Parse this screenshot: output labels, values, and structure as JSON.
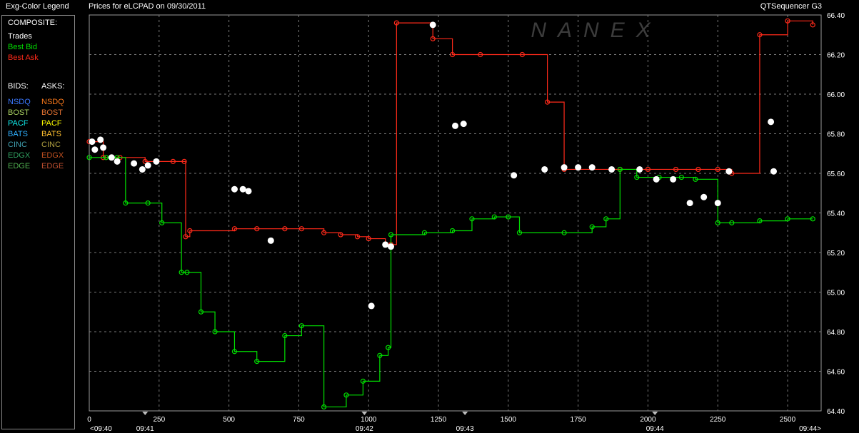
{
  "window": {
    "legend_title": "Exg-Color Legend",
    "chart_title": "Prices for  eLCPAD  on  09/30/2011",
    "app_name": "QTSequencer G3",
    "watermark": "NANEX"
  },
  "legend": {
    "composite_header": "COMPOSITE:",
    "composite": [
      {
        "label": "Trades",
        "color": "#ffffff"
      },
      {
        "label": "Best Bid",
        "color": "#00e000"
      },
      {
        "label": "Best Ask",
        "color": "#ff2a1a"
      }
    ],
    "bids_header": "BIDS:",
    "asks_header": "ASKS:",
    "exchanges": [
      {
        "bid": "NSDQ",
        "bid_color": "#3a78ff",
        "ask": "NSDQ",
        "ask_color": "#ff7a1a"
      },
      {
        "bid": "BOST",
        "bid_color": "#a8d060",
        "ask": "BOST",
        "ask_color": "#e07030"
      },
      {
        "bid": "PACF",
        "bid_color": "#10f0f0",
        "ask": "PACF",
        "ask_color": "#ffff00"
      },
      {
        "bid": "BATS",
        "bid_color": "#30b0ff",
        "ask": "BATS",
        "ask_color": "#ffc030"
      },
      {
        "bid": "CINC",
        "bid_color": "#40a0b0",
        "ask": "CINC",
        "ask_color": "#b0a040"
      },
      {
        "bid": "EDGX",
        "bid_color": "#30a060",
        "ask": "EDGX",
        "ask_color": "#c05020"
      },
      {
        "bid": "EDGE",
        "bid_color": "#50b050",
        "ask": "EDGE",
        "ask_color": "#c05030"
      }
    ]
  },
  "chart_data": {
    "type": "line",
    "title": "Prices for  eLCPAD  on  09/30/2011",
    "y_ticks": [
      "66.40",
      "66.20",
      "66.00",
      "65.80",
      "65.60",
      "65.40",
      "65.20",
      "65.00",
      "64.80",
      "64.60",
      "64.40"
    ],
    "ylim": [
      64.4,
      66.4
    ],
    "x_ticks": [
      "0",
      "250",
      "500",
      "750",
      "1000",
      "1250",
      "1500",
      "1750",
      "2000",
      "2250",
      "2500"
    ],
    "xlim": [
      0,
      2620
    ],
    "time_labels": [
      {
        "x": 0,
        "label": "<09:40"
      },
      {
        "x": 200,
        "label": "09:41"
      },
      {
        "x": 985,
        "label": "09:42"
      },
      {
        "x": 1345,
        "label": "09:43"
      },
      {
        "x": 2025,
        "label": "09:44"
      },
      {
        "x": 2620,
        "label": "09:44>"
      }
    ],
    "grid": true,
    "series": [
      {
        "name": "Best Ask",
        "color": "#ff2a1a",
        "points": [
          [
            0,
            65.76
          ],
          [
            50,
            65.68
          ],
          [
            110,
            65.68
          ],
          [
            200,
            65.66
          ],
          [
            300,
            65.66
          ],
          [
            340,
            65.66
          ],
          [
            345,
            65.28
          ],
          [
            360,
            65.31
          ],
          [
            520,
            65.32
          ],
          [
            600,
            65.32
          ],
          [
            700,
            65.32
          ],
          [
            760,
            65.32
          ],
          [
            840,
            65.3
          ],
          [
            900,
            65.29
          ],
          [
            960,
            65.28
          ],
          [
            1000,
            65.27
          ],
          [
            1060,
            65.24
          ],
          [
            1080,
            65.24
          ],
          [
            1100,
            66.36
          ],
          [
            1230,
            66.28
          ],
          [
            1300,
            66.2
          ],
          [
            1400,
            66.2
          ],
          [
            1550,
            66.2
          ],
          [
            1640,
            65.96
          ],
          [
            1700,
            65.62
          ],
          [
            1900,
            65.62
          ],
          [
            2000,
            65.62
          ],
          [
            2100,
            65.62
          ],
          [
            2180,
            65.62
          ],
          [
            2250,
            65.62
          ],
          [
            2300,
            65.6
          ],
          [
            2400,
            66.3
          ],
          [
            2500,
            66.37
          ],
          [
            2590,
            66.35
          ]
        ]
      },
      {
        "name": "Best Bid",
        "color": "#00e000",
        "points": [
          [
            0,
            65.68
          ],
          [
            60,
            65.68
          ],
          [
            100,
            65.68
          ],
          [
            130,
            65.45
          ],
          [
            210,
            65.45
          ],
          [
            260,
            65.35
          ],
          [
            330,
            65.1
          ],
          [
            350,
            65.1
          ],
          [
            400,
            64.9
          ],
          [
            450,
            64.8
          ],
          [
            520,
            64.7
          ],
          [
            600,
            64.65
          ],
          [
            700,
            64.78
          ],
          [
            760,
            64.83
          ],
          [
            840,
            64.42
          ],
          [
            920,
            64.48
          ],
          [
            980,
            64.55
          ],
          [
            1040,
            64.68
          ],
          [
            1070,
            64.72
          ],
          [
            1080,
            65.29
          ],
          [
            1200,
            65.3
          ],
          [
            1300,
            65.31
          ],
          [
            1370,
            65.37
          ],
          [
            1450,
            65.38
          ],
          [
            1500,
            65.38
          ],
          [
            1540,
            65.3
          ],
          [
            1700,
            65.3
          ],
          [
            1800,
            65.33
          ],
          [
            1850,
            65.37
          ],
          [
            1900,
            65.62
          ],
          [
            1960,
            65.58
          ],
          [
            2040,
            65.58
          ],
          [
            2120,
            65.58
          ],
          [
            2170,
            65.57
          ],
          [
            2250,
            65.35
          ],
          [
            2300,
            65.35
          ],
          [
            2400,
            65.36
          ],
          [
            2500,
            65.37
          ],
          [
            2590,
            65.37
          ]
        ]
      },
      {
        "name": "Trades",
        "color": "#ffffff",
        "markers": [
          [
            10,
            65.76
          ],
          [
            20,
            65.72
          ],
          [
            40,
            65.77
          ],
          [
            50,
            65.73
          ],
          [
            80,
            65.68
          ],
          [
            100,
            65.66
          ],
          [
            160,
            65.65
          ],
          [
            190,
            65.62
          ],
          [
            210,
            65.64
          ],
          [
            240,
            65.66
          ],
          [
            520,
            65.52
          ],
          [
            550,
            65.52
          ],
          [
            570,
            65.51
          ],
          [
            650,
            65.26
          ],
          [
            1010,
            64.93
          ],
          [
            1060,
            65.24
          ],
          [
            1080,
            65.23
          ],
          [
            1230,
            66.35
          ],
          [
            1310,
            65.84
          ],
          [
            1340,
            65.85
          ],
          [
            1520,
            65.59
          ],
          [
            1630,
            65.62
          ],
          [
            1700,
            65.63
          ],
          [
            1750,
            65.63
          ],
          [
            1800,
            65.63
          ],
          [
            1870,
            65.62
          ],
          [
            1970,
            65.62
          ],
          [
            2030,
            65.57
          ],
          [
            2090,
            65.57
          ],
          [
            2150,
            65.45
          ],
          [
            2200,
            65.48
          ],
          [
            2250,
            65.45
          ],
          [
            2290,
            65.61
          ],
          [
            2450,
            65.61
          ],
          [
            2440,
            65.86
          ]
        ]
      }
    ]
  }
}
